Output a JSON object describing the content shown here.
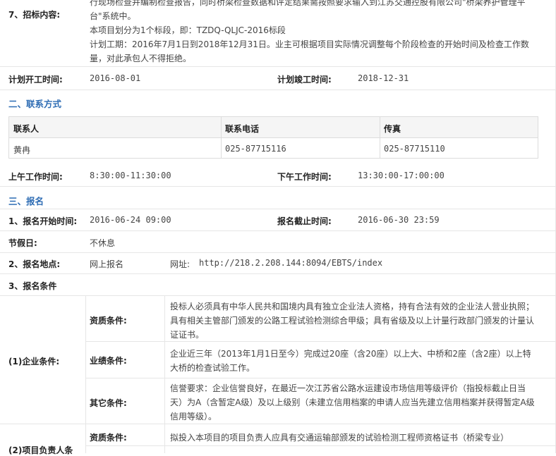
{
  "tender": {
    "label": "7、招标内容:",
    "lines": [
      "行现场检查并编制检查报告，同时桥梁检查数据和评定结果需按照要求输入到江苏交通控股有限公司\"桥梁养护管理平",
      "台\"系统中。",
      "本项目划分为1个标段，即：TZDQ-QLJC-2016标段",
      "计划工期：2016年7月1日到2018年12月31日。业主可根据项目实际情况调整每个阶段检查的开始时间及检查工作数",
      "量，对此承包人不得拒绝。"
    ]
  },
  "schedule": {
    "start_label": "计划开工时间:",
    "start_value": "2016-08-01",
    "end_label": "计划竣工时间:",
    "end_value": "2018-12-31"
  },
  "contact": {
    "section_title": "二、联系方式",
    "headers": [
      "联系人",
      "联系电话",
      "传真"
    ],
    "row": [
      "黄冉",
      "025-87715116",
      "025-87715110"
    ],
    "am_label": "上午工作时间:",
    "am_value": "8:30:00-11:30:00",
    "pm_label": "下午工作时间:",
    "pm_value": "13:30:00-17:00:00"
  },
  "registration": {
    "section_title": "三、报名",
    "start_label": "1、报名开始时间:",
    "start_value": "2016-06-24 09:00",
    "end_label": "报名截止时间:",
    "end_value": "2016-06-30 23:59",
    "holiday_label": "节假日:",
    "holiday_value": "不休息",
    "place_label": "2、报名地点:",
    "place_value": "网上报名",
    "url_label": "网址:",
    "url_value": "http://218.2.208.144:8094/EBTS/index",
    "conditions_label": "3、报名条件"
  },
  "conditions": {
    "enterprise_label": "(1)企业条件:",
    "qual_label": "资质条件:",
    "qual_text": [
      "投标人必须具有中华人民共和国境内具有独立企业法人资格，持有合法有效的企业法人营业执照；",
      "具有相关主管部门颁发的公路工程试验检测综合甲级；具有省级及以上计量行政部门颁发的计量认",
      "证证书。"
    ],
    "perf_label": "业绩条件:",
    "perf_text": [
      "企业近三年（2013年1月1日至今）完成过20座（含20座）以上大、中桥和2座（含2座）以上特",
      "大桥的检查试验工作。"
    ],
    "other_label": "其它条件:",
    "other_text": [
      "信誉要求：企业信誉良好，在最近一次江苏省公路水运建设市场信用等级评价（指投标截止日当",
      "天）为A（含暂定A级）及以上级别（未建立信用档案的申请人应当先建立信用档案并获得暂定A级",
      "信用等级）。"
    ],
    "leader_label": "(2)项目负责人条",
    "leader_qual_label": "资质条件:",
    "leader_qual_text": "拟投入本项目的项目负责人应具有交通运输部颁发的试验检测工程师资格证书（桥梁专业）"
  }
}
